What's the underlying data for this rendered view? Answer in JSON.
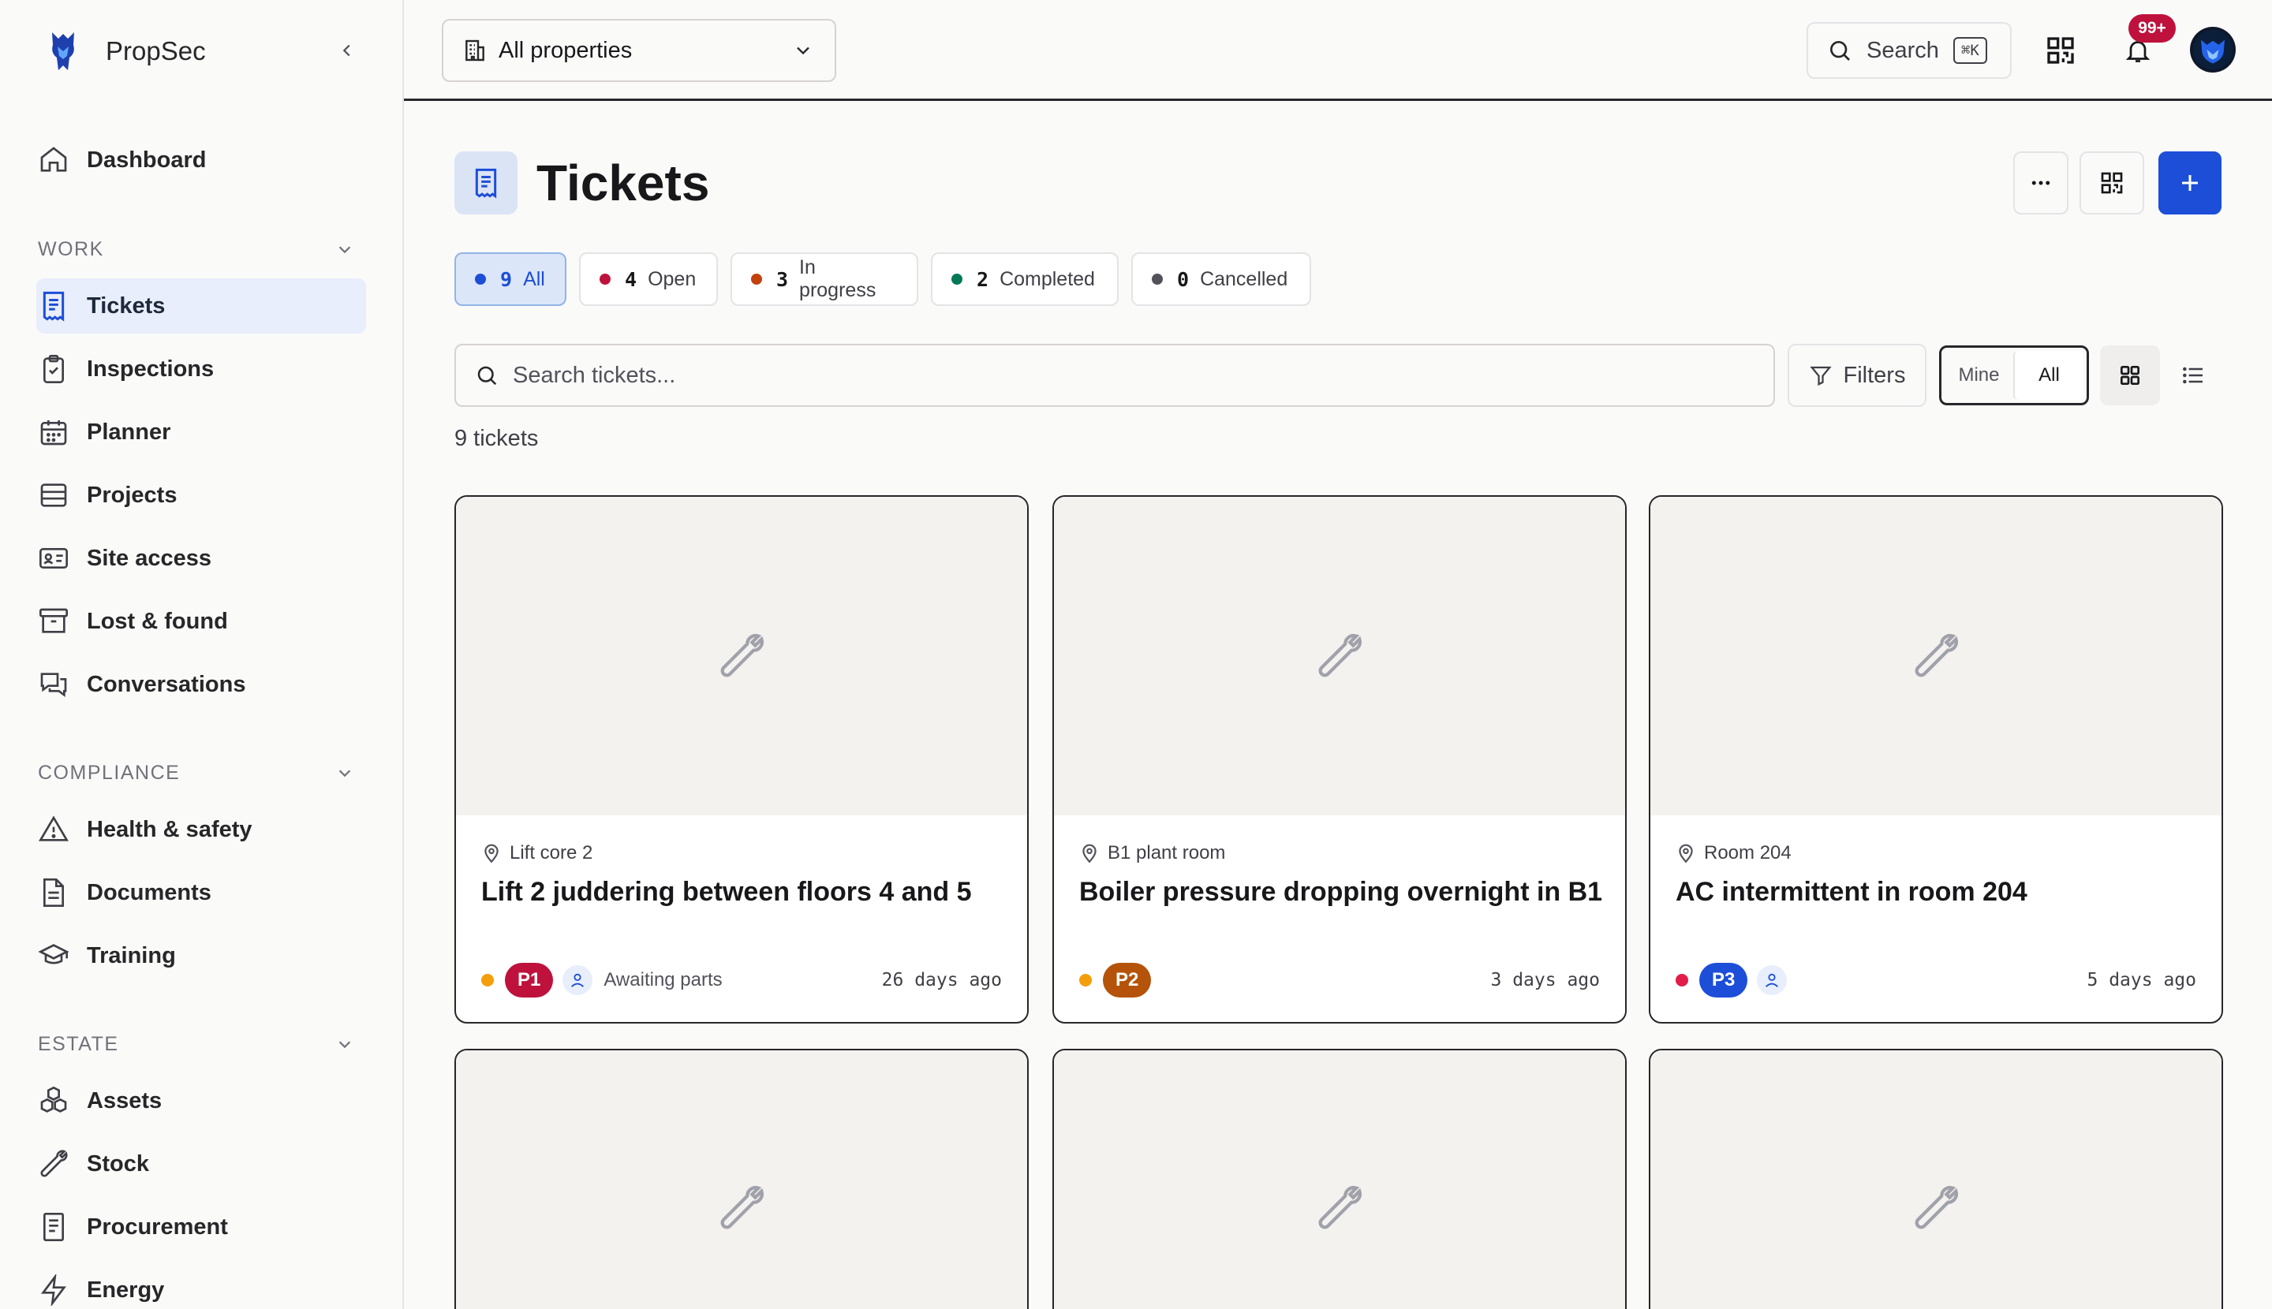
{
  "app": {
    "name": "PropSec"
  },
  "sidebar": {
    "dashboard": "Dashboard",
    "sections": [
      {
        "title": "WORK",
        "items": [
          "Tickets",
          "Inspections",
          "Planner",
          "Projects",
          "Site access",
          "Lost & found",
          "Conversations"
        ]
      },
      {
        "title": "COMPLIANCE",
        "items": [
          "Health & safety",
          "Documents",
          "Training"
        ]
      },
      {
        "title": "ESTATE",
        "items": [
          "Assets",
          "Stock",
          "Procurement",
          "Energy"
        ]
      }
    ],
    "active_item": "Tickets"
  },
  "topbar": {
    "property_select": "All properties",
    "search_label": "Search",
    "search_shortcut": "⌘K",
    "notification_badge": "99+"
  },
  "page": {
    "title": "Tickets",
    "chips": [
      {
        "count": "9",
        "label": "All",
        "color": "#1d4ed8"
      },
      {
        "count": "4",
        "label": "Open",
        "color": "#be123c"
      },
      {
        "count": "3",
        "label": "In progress",
        "color": "#c2410c"
      },
      {
        "count": "2",
        "label": "Completed",
        "color": "#047857"
      },
      {
        "count": "0",
        "label": "Cancelled",
        "color": "#52525b"
      }
    ],
    "search_placeholder": "Search tickets...",
    "filters_label": "Filters",
    "scope": {
      "mine": "Mine",
      "all": "All"
    },
    "ticket_count": "9 tickets"
  },
  "tickets": [
    {
      "location": "Lift core 2",
      "title": "Lift 2 juddering between floors 4 and 5",
      "priority": "P1",
      "priority_color": "#be123c",
      "status_dot": "#f59e0b",
      "status": "Awaiting parts",
      "age": "26 days ago"
    },
    {
      "location": "B1 plant room",
      "title": "Boiler pressure dropping overnight in B1",
      "priority": "P2",
      "priority_color": "#b45309",
      "status_dot": "#f59e0b",
      "status": "",
      "age": "3 days ago"
    },
    {
      "location": "Room 204",
      "title": "AC intermittent in room 204",
      "priority": "P3",
      "priority_color": "#1d4ed8",
      "status_dot": "#e11d48",
      "status": "",
      "age": "5 days ago"
    }
  ]
}
